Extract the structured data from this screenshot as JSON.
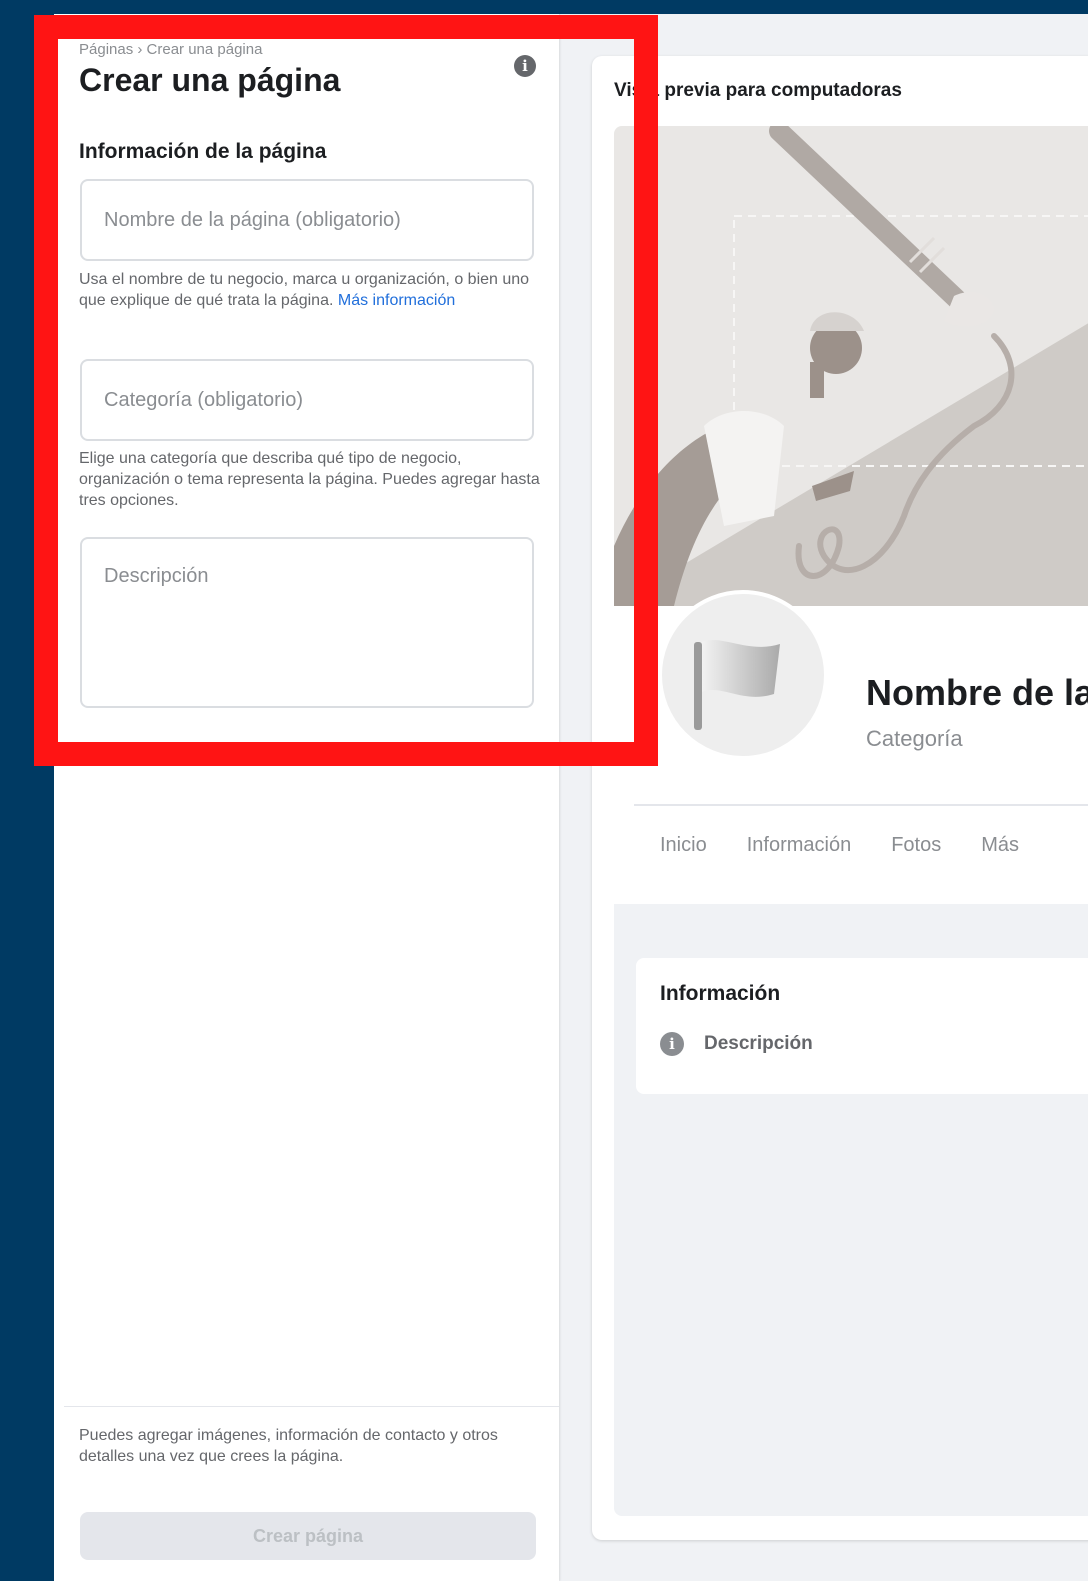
{
  "breadcrumb": "Páginas › Crear una página",
  "title": "Crear una página",
  "info_icon_glyph": "i",
  "section_title": "Información de la página",
  "fields": {
    "name_placeholder": "Nombre de la página (obligatorio)",
    "name_help": "Usa el nombre de tu negocio, marca u organización, o bien uno que explique de qué trata la página.",
    "name_help_link": "Más información",
    "category_placeholder": "Categoría (obligatorio)",
    "category_help": "Elige una categoría que describa qué tipo de negocio, organización o tema representa la página. Puedes agregar hasta tres opciones.",
    "description_placeholder": "Descripción"
  },
  "footer": {
    "note": "Puedes agregar imágenes, información de contacto y otros detalles una vez que crees la página.",
    "create_button": "Crear página"
  },
  "preview": {
    "label": "Vista previa para computadoras",
    "page_name": "Nombre de la página",
    "category": "Categoría",
    "tabs": [
      "Inicio",
      "Información",
      "Fotos",
      "Más"
    ],
    "about_title": "Información",
    "about_description": "Descripción"
  },
  "colors": {
    "background": "#003a63",
    "highlight": "#ff1414",
    "link": "#216fdb"
  }
}
